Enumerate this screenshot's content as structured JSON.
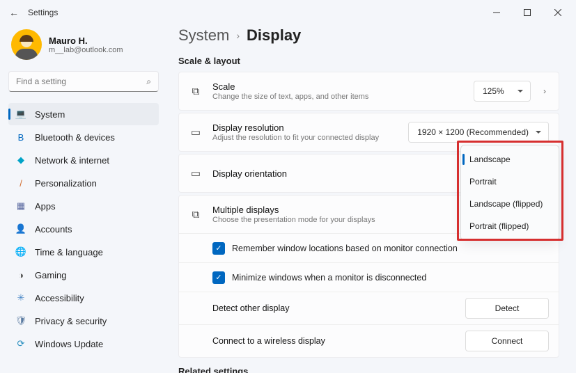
{
  "titlebar": {
    "label": "Settings"
  },
  "profile": {
    "name": "Mauro H.",
    "email": "m__lab@outlook.com"
  },
  "search": {
    "placeholder": "Find a setting"
  },
  "nav": {
    "items": [
      {
        "label": "System",
        "icon": "💻",
        "name": "system",
        "active": true
      },
      {
        "label": "Bluetooth & devices",
        "icon": "B",
        "name": "bluetooth",
        "color": "#0067c0"
      },
      {
        "label": "Network & internet",
        "icon": "◆",
        "name": "network",
        "color": "#00a3c7"
      },
      {
        "label": "Personalization",
        "icon": "/",
        "name": "personalization",
        "color": "#d06a2a"
      },
      {
        "label": "Apps",
        "icon": "▦",
        "name": "apps",
        "color": "#5b6aa0"
      },
      {
        "label": "Accounts",
        "icon": "👤",
        "name": "accounts",
        "color": "#555"
      },
      {
        "label": "Time & language",
        "icon": "🌐",
        "name": "time-language",
        "color": "#3a8dd0"
      },
      {
        "label": "Gaming",
        "icon": "◑",
        "name": "gaming",
        "color": "#555"
      },
      {
        "label": "Accessibility",
        "icon": "✳",
        "name": "accessibility",
        "color": "#4a88c7"
      },
      {
        "label": "Privacy & security",
        "icon": "🛡",
        "name": "privacy",
        "color": "#5a7aa0"
      },
      {
        "label": "Windows Update",
        "icon": "⟳",
        "name": "windows-update",
        "color": "#2a90c0"
      }
    ]
  },
  "breadcrumb": {
    "system": "System",
    "sep": "›",
    "display": "Display"
  },
  "sections": {
    "scale_layout": "Scale & layout",
    "related": "Related settings"
  },
  "rows": {
    "scale": {
      "title": "Scale",
      "sub": "Change the size of text, apps, and other items",
      "value": "125%"
    },
    "resolution": {
      "title": "Display resolution",
      "sub": "Adjust the resolution to fit your connected display",
      "value": "1920 × 1200 (Recommended)"
    },
    "orientation": {
      "title": "Display orientation"
    },
    "multiple": {
      "title": "Multiple displays",
      "sub": "Choose the presentation mode for your displays"
    },
    "remember": {
      "label": "Remember window locations based on monitor connection",
      "checked": true
    },
    "minimize": {
      "label": "Minimize windows when a monitor is disconnected",
      "checked": true
    },
    "detect": {
      "title": "Detect other display",
      "button": "Detect"
    },
    "connect": {
      "title": "Connect to a wireless display",
      "button": "Connect"
    }
  },
  "orientation_options": [
    {
      "label": "Landscape",
      "selected": true
    },
    {
      "label": "Portrait"
    },
    {
      "label": "Landscape (flipped)"
    },
    {
      "label": "Portrait (flipped)"
    }
  ]
}
